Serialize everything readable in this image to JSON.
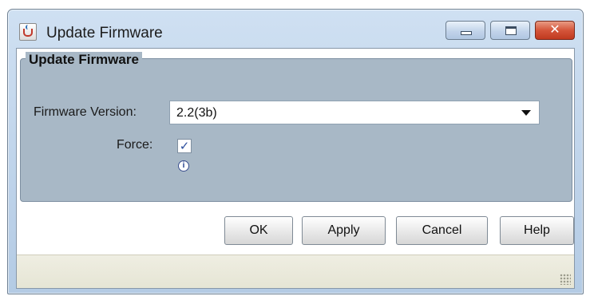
{
  "window": {
    "title": "Update Firmware",
    "close_glyph": "✕",
    "colors": {
      "titlebar": "#bed3ea",
      "close": "#d4553a"
    }
  },
  "group": {
    "title": "Update Firmware",
    "color": "#a8b8c6"
  },
  "firmware": {
    "label": "Firmware Version:",
    "value": "2.2(3b)"
  },
  "force": {
    "label": "Force:",
    "checked": true,
    "check_glyph": "✓",
    "info_glyph": "i"
  },
  "buttons": {
    "ok": "OK",
    "apply": "Apply",
    "cancel": "Cancel",
    "help": "Help"
  }
}
